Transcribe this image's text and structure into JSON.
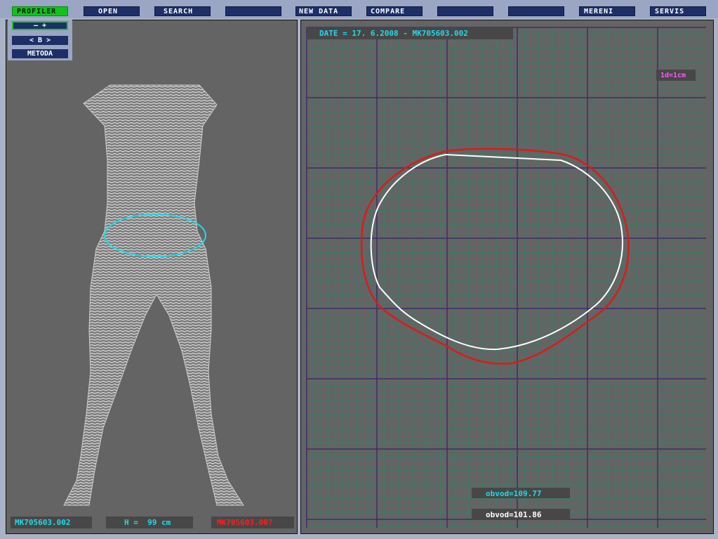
{
  "toolbar": {
    "profiler": "PROFILER",
    "open": "OPEN",
    "search": "SEARCH",
    "blank1": "",
    "new_data": "NEW DATA",
    "compare": "COMPARE",
    "blank2": "",
    "blank3": "",
    "mereni": "MERENI",
    "servis": "SERVIS"
  },
  "controls": {
    "zoom": "–    +",
    "nav": "<    B    >",
    "metoda": "METODA"
  },
  "left_panel": {
    "file_id": "MK705603.002",
    "height": "H =  99 cm",
    "file_id_red": "MK705603.00?"
  },
  "right_panel": {
    "date": "DATE = 17. 6.2008 - MK705603.002",
    "scale": "1d=1cm",
    "obvod_red": "obvod=109.77",
    "obvod_white": "obvod=101.86"
  },
  "colors": {
    "background": "#646464",
    "grid_major": "#3a2f6a",
    "grid_minor": "#1e8a6a",
    "contour_red": "#dd1a1a",
    "contour_white": "#ffffff",
    "slice_ring": "#22d8e8",
    "button": "#1e2f68",
    "active_button": "#11c21a"
  },
  "icons": [
    "body-scan-wireframe",
    "cross-section-contour"
  ]
}
